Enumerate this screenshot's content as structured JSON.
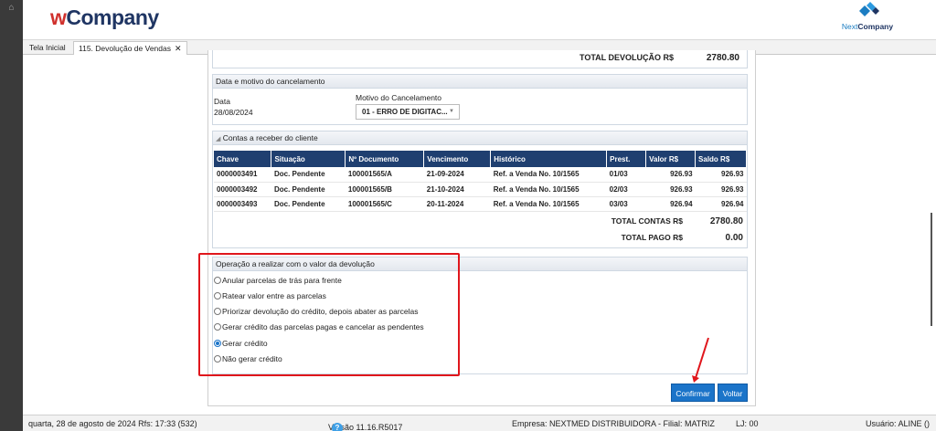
{
  "header": {
    "logo_w": "w",
    "logo_rest": "Company",
    "next_logo_a": "Next",
    "next_logo_b": "Company"
  },
  "tabs": [
    {
      "label": "Tela Inicial"
    },
    {
      "label": "115. Devolução de Vendas",
      "close": "✕"
    }
  ],
  "total_devolucao": {
    "label": "TOTAL DEVOLUÇÃO R$",
    "value": "2780.80"
  },
  "cancelamento": {
    "title": "Data e motivo do cancelamento",
    "data_label": "Data",
    "data_value": "28/08/2024",
    "motivo_label": "Motivo do Cancelamento",
    "motivo_value": "01 - ERRO DE DIGITAC..."
  },
  "contas": {
    "title": "Contas a receber do cliente",
    "columns": [
      "Chave",
      "Situação",
      "Nº Documento",
      "Vencimento",
      "Histórico",
      "Prest.",
      "Valor R$",
      "Saldo R$"
    ],
    "rows": [
      [
        "0000003491",
        "Doc. Pendente",
        "100001565/A",
        "21-09-2024",
        "Ref. a Venda No. 10/1565",
        "01/03",
        "926.93",
        "926.93"
      ],
      [
        "0000003492",
        "Doc. Pendente",
        "100001565/B",
        "21-10-2024",
        "Ref. a Venda No. 10/1565",
        "02/03",
        "926.93",
        "926.93"
      ],
      [
        "0000003493",
        "Doc. Pendente",
        "100001565/C",
        "20-11-2024",
        "Ref. a Venda No. 10/1565",
        "03/03",
        "926.94",
        "926.94"
      ]
    ],
    "total_contas_label": "TOTAL CONTAS R$",
    "total_contas_value": "2780.80",
    "total_pago_label": "TOTAL PAGO R$",
    "total_pago_value": "0.00"
  },
  "operacao": {
    "title": "Operação a realizar com o valor da devolução",
    "options": [
      {
        "label": "Anular parcelas de trás para frente",
        "selected": false
      },
      {
        "label": "Ratear valor entre as parcelas",
        "selected": false
      },
      {
        "label": "Priorizar devolução do crédito, depois abater as parcelas",
        "selected": false
      },
      {
        "label": "Gerar crédito das parcelas pagas e cancelar as pendentes",
        "selected": false
      },
      {
        "label": "Gerar crédito",
        "selected": true
      },
      {
        "label": "Não gerar crédito",
        "selected": false
      }
    ]
  },
  "buttons": {
    "confirmar": "Confirmar",
    "voltar": "Voltar"
  },
  "status": {
    "datetime": "quarta, 28 de agosto de 2024  Rfs: 17:33 (532)",
    "versao": "Versão 11.16.R5017",
    "help": "?",
    "empresa": "Empresa: NEXTMED DISTRIBUIDORA - Filial: MATRIZ",
    "lj": "LJ: 00",
    "usuario": "Usuário: ALINE ()"
  },
  "colors": {
    "accent": "#1b74c9",
    "header_blue": "#1f3f70",
    "highlight": "#e0161c"
  }
}
